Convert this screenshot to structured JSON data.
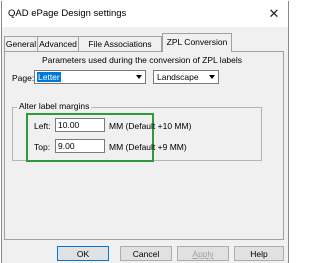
{
  "window": {
    "title": "QAD ePage Design settings",
    "close_glyph": "✕"
  },
  "tabs": [
    {
      "label": "General"
    },
    {
      "label": "Advanced"
    },
    {
      "label": "File Associations"
    },
    {
      "label": "ZPL Conversion",
      "active": true
    }
  ],
  "panel": {
    "description": "Parameters used during the conversion of ZPL labels",
    "page_label": "Page:",
    "page_size": {
      "value": "Letter"
    },
    "orientation": {
      "value": "Landscape"
    },
    "margins_group": {
      "title": "Alter label margins",
      "left": {
        "label": "Left:",
        "value": "10.00",
        "unit": "MM  (Default +10 MM)"
      },
      "top": {
        "label": "Top:",
        "value": "9.00",
        "unit": "MM  (Default +9 MM)"
      }
    }
  },
  "buttons": {
    "ok": "OK",
    "cancel": "Cancel",
    "apply": "Apply",
    "help": "Help"
  }
}
